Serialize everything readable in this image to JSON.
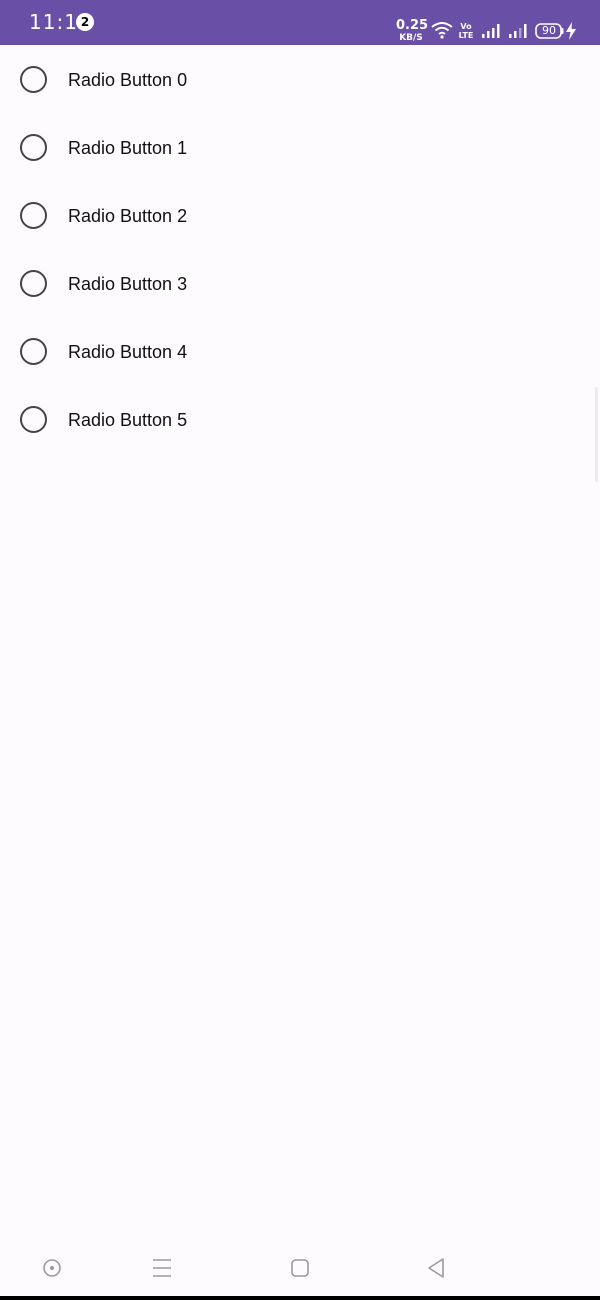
{
  "status_bar": {
    "time": "11:13",
    "notification_count": "2",
    "net_speed_value": "0.25",
    "net_speed_unit": "KB/S",
    "volte_label": "Vo LTE",
    "battery_level": "90",
    "bg_color": "#6a4fa6"
  },
  "radio_group": {
    "items": [
      {
        "label": "Radio Button 0",
        "checked": false
      },
      {
        "label": "Radio Button 1",
        "checked": false
      },
      {
        "label": "Radio Button 2",
        "checked": false
      },
      {
        "label": "Radio Button 3",
        "checked": false
      },
      {
        "label": "Radio Button 4",
        "checked": false
      },
      {
        "label": "Radio Button 5",
        "checked": false
      }
    ]
  },
  "nav_bar": {
    "buttons": [
      "assistant-icon",
      "recents-icon",
      "home-icon",
      "back-icon"
    ]
  }
}
